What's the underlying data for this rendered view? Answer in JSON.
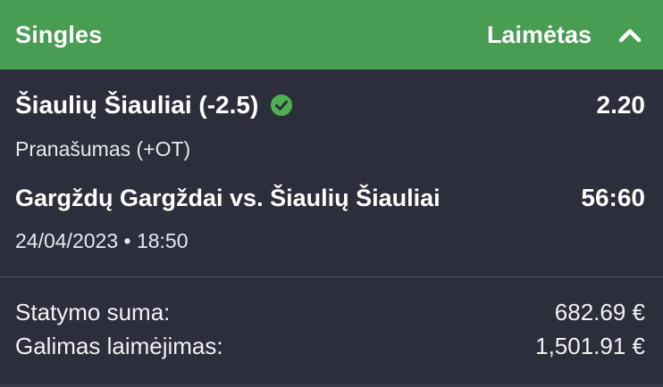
{
  "header": {
    "title": "Singles",
    "status": "Laimėtas",
    "toggle_icon": "chevron-up-icon"
  },
  "selection": {
    "name": "Šiaulių Šiauliai (-2.5)",
    "status_icon": "check-circle-icon",
    "odds": "2.20",
    "market": "Pranašumas (+OT)"
  },
  "event": {
    "name": "Gargždų Gargždai vs. Šiaulių Šiauliai",
    "score": "56:60",
    "datetime": "24/04/2023 • 18:50"
  },
  "summary": {
    "stake_label": "Statymo suma:",
    "stake_value": "682.69 €",
    "win_label": "Galimas laimėjimas:",
    "win_value": "1,501.91 €"
  },
  "colors": {
    "header_bg": "#489d52",
    "card_bg": "#2c2e3b",
    "check_green": "#4caf50"
  }
}
